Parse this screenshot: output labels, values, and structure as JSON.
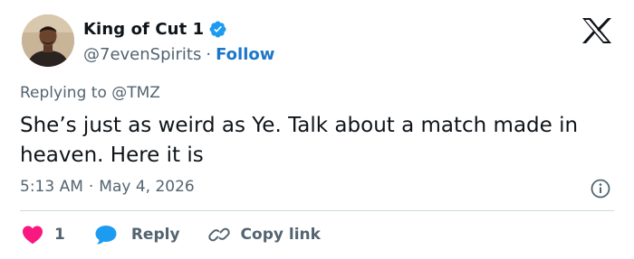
{
  "author": {
    "name": "King of Cut 1",
    "handle": "@7evenSpirits",
    "separator": "·",
    "follow_label": "Follow"
  },
  "reply_context": "Replying to @TMZ",
  "tweet": {
    "text": "She’s just as weird as Ye. Talk about a match made in heaven. Here it is",
    "time": "5:13 AM",
    "date_separator": "·",
    "date": "May 4, 2026"
  },
  "actions": {
    "like_count": "1",
    "reply_label": "Reply",
    "copy_label": "Copy link"
  },
  "icons": {
    "verified": "verified-badge-icon",
    "logo": "x-logo-icon",
    "info": "info-icon",
    "like": "heart-icon",
    "reply": "speech-bubble-icon",
    "copy": "link-icon"
  },
  "colors": {
    "verified": "#1d9bf0",
    "follow": "#1d77c9",
    "like": "#f91880",
    "reply": "#1d9bf0",
    "muted": "#536471",
    "text": "#0f1419"
  }
}
